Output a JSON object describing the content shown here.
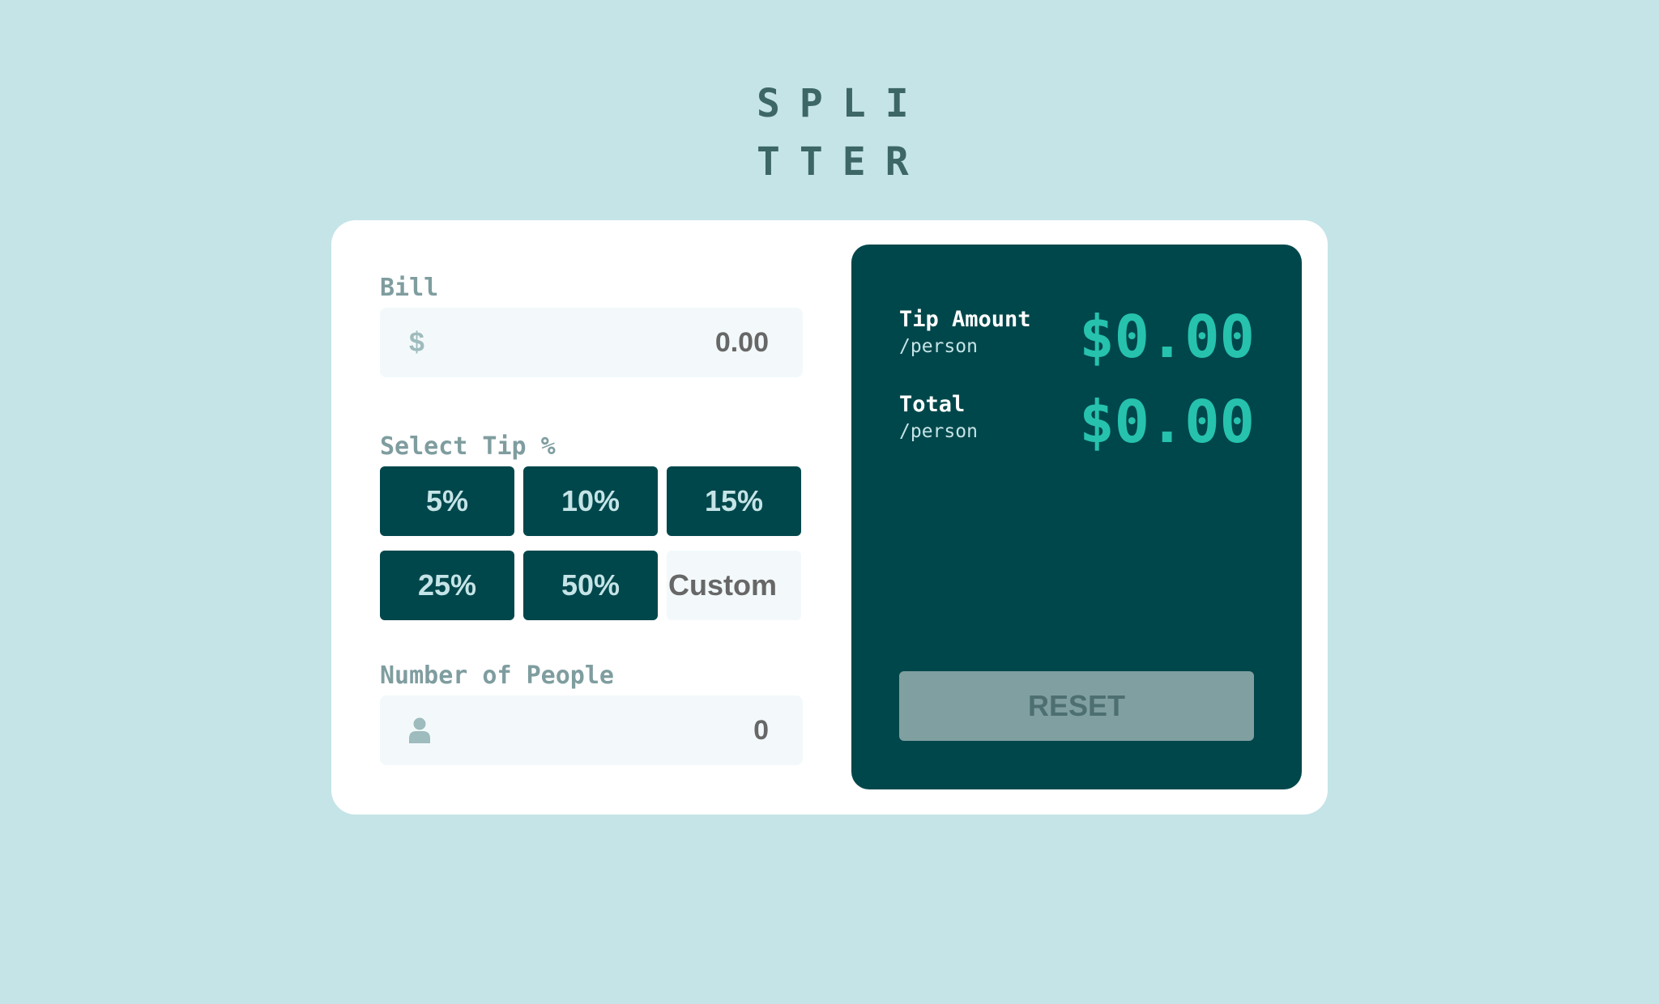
{
  "logo": {
    "line1": "SPLI",
    "line2": "TTER"
  },
  "bill": {
    "label": "Bill",
    "currency_symbol": "$",
    "value": "0.00",
    "icon": "dollar-icon"
  },
  "tip": {
    "label": "Select Tip %",
    "options": [
      "5%",
      "10%",
      "15%",
      "25%",
      "50%"
    ],
    "custom_placeholder": "Custom"
  },
  "people": {
    "label": "Number of People",
    "value": "0",
    "icon": "person-icon"
  },
  "results": {
    "tip_amount": {
      "title": "Tip Amount",
      "unit": "/person",
      "value": "$0.00"
    },
    "total": {
      "title": "Total",
      "unit": "/person",
      "value": "$0.00"
    },
    "reset_label": "RESET"
  },
  "colors": {
    "background": "#c5e4e7",
    "panel": "#00474b",
    "accent": "#26c2ad",
    "reset_disabled": "#809fa0"
  }
}
